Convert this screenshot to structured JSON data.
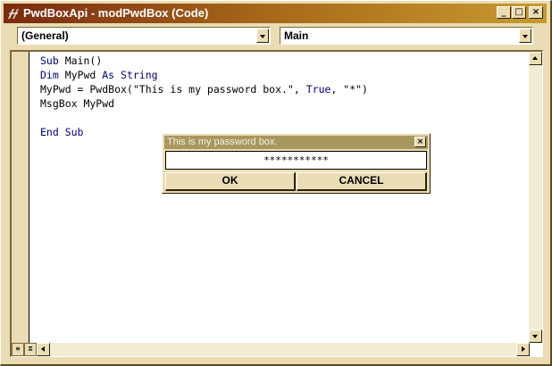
{
  "window": {
    "title": "PwdBoxApi - modPwdBox (Code)",
    "controls": {
      "minimize": "_",
      "maximize": "□",
      "close": "×"
    }
  },
  "object_combo": {
    "value": "(General)"
  },
  "procedure_combo": {
    "value": "Main"
  },
  "code": {
    "lines": [
      [
        {
          "t": "Sub ",
          "k": true
        },
        {
          "t": "Main()"
        }
      ],
      [
        {
          "t": "Dim ",
          "k": true
        },
        {
          "t": "MyPwd "
        },
        {
          "t": "As String",
          "k": true
        }
      ],
      [
        {
          "t": "MyPwd = PwdBox(\"This is my password box.\", "
        },
        {
          "t": "True",
          "k": true
        },
        {
          "t": ", \"*\")"
        }
      ],
      [
        {
          "t": "MsgBox MyPwd"
        }
      ],
      [
        {
          "t": ""
        }
      ],
      [
        {
          "t": "End Sub",
          "k": true
        }
      ]
    ]
  },
  "dialog": {
    "title": "This is my password box.",
    "close": "×",
    "input_value": "***********",
    "ok_label": "OK",
    "cancel_label": "CANCEL"
  },
  "colors": {
    "keyword": "#00007f",
    "titlebar_start": "#7a2a10",
    "titlebar_end": "#c89a30",
    "chrome": "#eadcb4"
  }
}
